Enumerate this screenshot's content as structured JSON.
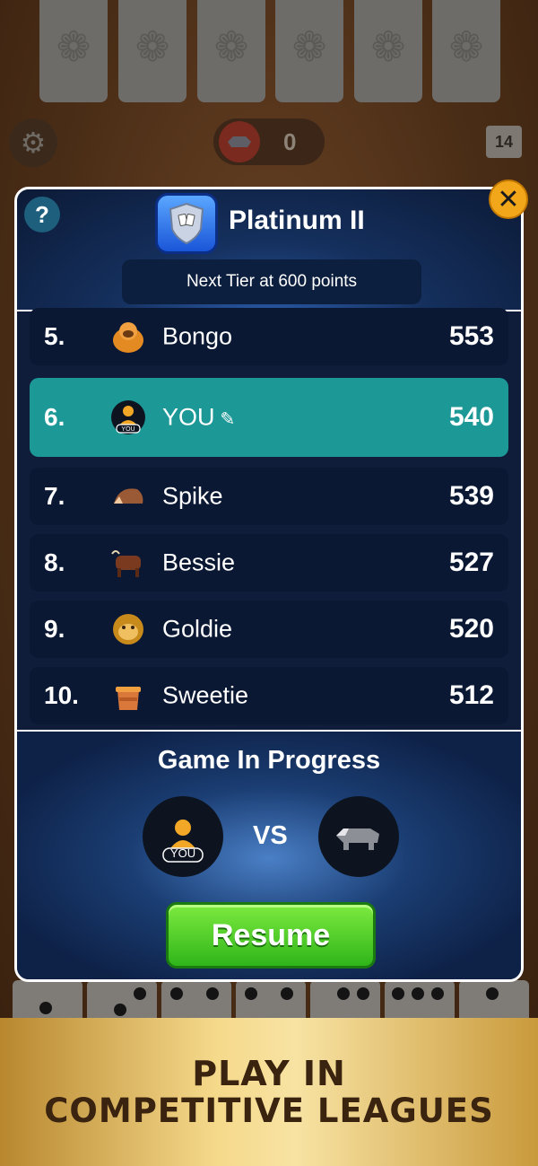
{
  "top_bar": {
    "opponent_score": "0",
    "boneyard_count": "14"
  },
  "modal": {
    "help_label": "?",
    "tier_name": "Platinum II",
    "next_tier_text": "Next Tier at 600 points",
    "close_label": "✕"
  },
  "leaderboard": [
    {
      "rank": "5.",
      "name": "Bongo",
      "points": "553",
      "avatar": "orangutan-icon"
    },
    {
      "rank": "6.",
      "name": "YOU",
      "points": "540",
      "avatar": "player-avatar-icon",
      "is_me": true
    },
    {
      "rank": "7.",
      "name": "Spike",
      "points": "539",
      "avatar": "hedgehog-icon"
    },
    {
      "rank": "8.",
      "name": "Bessie",
      "points": "527",
      "avatar": "bull-icon"
    },
    {
      "rank": "9.",
      "name": "Goldie",
      "points": "520",
      "avatar": "monkey-icon"
    },
    {
      "rank": "10.",
      "name": "Sweetie",
      "points": "512",
      "avatar": "honey-pot-icon"
    }
  ],
  "game_in_progress": {
    "title": "Game In Progress",
    "you_label": "YOU",
    "vs_label": "VS",
    "opponent_avatar": "badger-icon",
    "resume_label": "Resume"
  },
  "banner": {
    "line1": "PLAY IN",
    "line2": "COMPETITIVE LEAGUES"
  },
  "colors": {
    "my_row": "#1c9896",
    "row": "#0b1833",
    "resume": "#3fc424",
    "close": "#f2a71b",
    "banner_text": "#3a230f"
  }
}
